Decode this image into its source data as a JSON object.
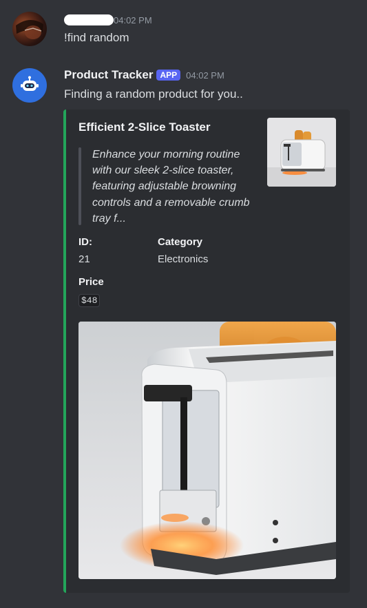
{
  "messages": [
    {
      "author": "",
      "timestamp": "04:02 PM",
      "text": "!find random"
    },
    {
      "author": "Product Tracker",
      "tag": "APP",
      "timestamp": "04:02 PM",
      "text": "Finding a random product for you..",
      "embed": {
        "accent_color": "#23a55a",
        "title": "Efficient 2-Slice Toaster",
        "description": "Enhance your morning routine with our sleek 2-slice toaster, featuring adjustable browning controls and a removable crumb tray f...",
        "fields": [
          {
            "name": "ID:",
            "value": "21"
          },
          {
            "name": "Category",
            "value": "Electronics"
          },
          {
            "name": "Price",
            "value": "$48"
          }
        ],
        "thumbnail": "toaster-thumbnail",
        "image": "toaster-image"
      }
    }
  ]
}
